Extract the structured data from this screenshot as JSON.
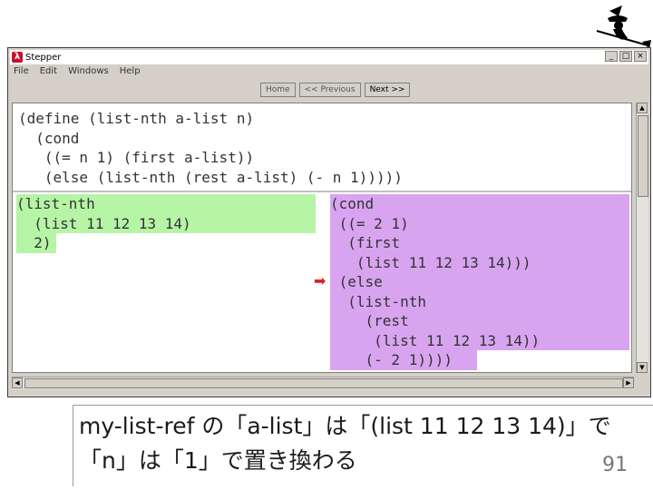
{
  "window": {
    "title": "Stepper",
    "menu": [
      "File",
      "Edit",
      "Windows",
      "Help"
    ],
    "buttons": {
      "home": "Home",
      "previous": "<< Previous",
      "next": "Next >>"
    },
    "win_controls": [
      "_",
      "□",
      "×"
    ]
  },
  "definition": [
    "(define (list-nth a-list n)",
    "  (cond",
    "   ((= n 1) (first a-list))",
    "   (else (list-nth (rest a-list) (- n 1)))))"
  ],
  "left_expr": [
    "(list-nth",
    "  (list 11 12 13 14)",
    "  2)"
  ],
  "right_expr": [
    "(cond",
    " ((= 2 1)",
    "  (first",
    "   (list 11 12 13 14)))",
    " (else",
    "  (list-nth",
    "    (rest",
    "     (list 11 12 13 14))",
    "    (- 2 1))))"
  ],
  "caption": {
    "line1": "my-list-ref の「a-list」は「(list 11 12 13 14)」で",
    "line2": "「n」は「1」で置き換わる"
  },
  "page_number": "91",
  "colors": {
    "left_highlight": "#b6f4a6",
    "right_highlight": "#d8a4f0",
    "arrow": "#e02020"
  }
}
